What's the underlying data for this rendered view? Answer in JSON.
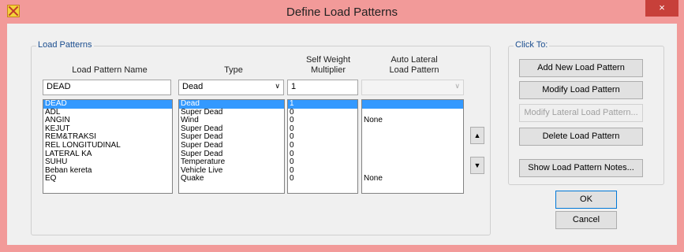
{
  "window": {
    "title": "Define Load Patterns",
    "close_label": "×"
  },
  "load_patterns": {
    "group_label": "Load Patterns",
    "headers": {
      "name": "Load Pattern Name",
      "type": "Type",
      "multiplier": "Self Weight\nMultiplier",
      "auto_lateral": "Auto Lateral\nLoad Pattern"
    },
    "edit": {
      "name": "DEAD",
      "type": "Dead",
      "multiplier": "1",
      "auto_lateral": ""
    },
    "rows": [
      {
        "name": "DEAD",
        "type": "Dead",
        "multiplier": "1",
        "auto_lateral": ""
      },
      {
        "name": "ADL",
        "type": "Super Dead",
        "multiplier": "0",
        "auto_lateral": ""
      },
      {
        "name": "ANGIN",
        "type": "Wind",
        "multiplier": "0",
        "auto_lateral": "None"
      },
      {
        "name": "KEJUT",
        "type": "Super Dead",
        "multiplier": "0",
        "auto_lateral": ""
      },
      {
        "name": "REM&TRAKSI",
        "type": "Super Dead",
        "multiplier": "0",
        "auto_lateral": ""
      },
      {
        "name": "REL LONGITUDINAL",
        "type": "Super Dead",
        "multiplier": "0",
        "auto_lateral": ""
      },
      {
        "name": "LATERAL KA",
        "type": "Super Dead",
        "multiplier": "0",
        "auto_lateral": ""
      },
      {
        "name": "SUHU",
        "type": "Temperature",
        "multiplier": "0",
        "auto_lateral": ""
      },
      {
        "name": "Beban kereta",
        "type": "Vehicle Live",
        "multiplier": "0",
        "auto_lateral": ""
      },
      {
        "name": "EQ",
        "type": "Quake",
        "multiplier": "0",
        "auto_lateral": "None"
      }
    ],
    "selected_index": 0
  },
  "actions": {
    "group_label": "Click To:",
    "add": "Add New Load Pattern",
    "modify": "Modify Load Pattern",
    "modify_lateral": "Modify Lateral Load Pattern...",
    "delete": "Delete Load Pattern",
    "notes": "Show Load Pattern Notes..."
  },
  "footer": {
    "ok": "OK",
    "cancel": "Cancel"
  }
}
